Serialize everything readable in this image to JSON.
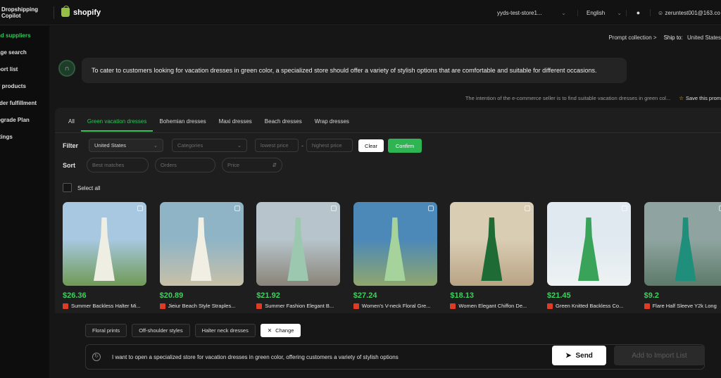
{
  "topbar": {
    "brand_line1": "Dropshipping",
    "brand_line2": "Copilot",
    "platform": "shopify",
    "store": "yyds-test-store1...",
    "language": "English",
    "user": "zeruntest001@163.co"
  },
  "sidebar": {
    "items": [
      {
        "label": "nd suppliers",
        "active": true
      },
      {
        "label": "age search",
        "active": false
      },
      {
        "label": "port list",
        "active": false
      },
      {
        "label": "y products",
        "active": false
      },
      {
        "label": "rder fulfillment",
        "active": false
      },
      {
        "label": "pgrade Plan",
        "active": false
      },
      {
        "label": "ttings",
        "active": false
      }
    ]
  },
  "header": {
    "prompt_collection": "Prompt collection >",
    "ship_to_label": "Ship to:",
    "ship_to_value": "United States"
  },
  "assistant": {
    "message": "To cater to customers looking for vacation dresses in green color, a specialized store should offer a variety of stylish options that are comfortable and suitable for different occasions."
  },
  "intention": {
    "text": "The intention of the e-commerce seller is to find suitable vacation dresses in green col...",
    "save_label": "Save this prom"
  },
  "tabs": [
    "All",
    "Green vacation dresses",
    "Bohemian dresses",
    "Maxi dresses",
    "Beach dresses",
    "Wrap dresses"
  ],
  "filter": {
    "label": "Filter",
    "country": "United States",
    "categories_placeholder": "Categories",
    "lowest_placeholder": "lowest price",
    "dash": "-",
    "highest_placeholder": "highest price",
    "clear": "Clear",
    "confirm": "Confirm"
  },
  "sort": {
    "label": "Sort",
    "best_placeholder": "Best matches",
    "orders_placeholder": "Orders",
    "price_placeholder": "Price"
  },
  "select_all": "Select all",
  "products": [
    {
      "price": "$26.36",
      "title": "Summer Backless Halter Mi...",
      "colors": [
        "#a7c8e0",
        "#6f9a55",
        "#eeeee2"
      ]
    },
    {
      "price": "$20.89",
      "title": "Jieiur Beach Style Straples...",
      "colors": [
        "#8fb4c6",
        "#c8c0a8",
        "#f1efe4"
      ]
    },
    {
      "price": "$21.92",
      "title": "Summer Fashion Elegant B...",
      "colors": [
        "#b7c4cc",
        "#8a8478",
        "#9dc8b0"
      ]
    },
    {
      "price": "$27.24",
      "title": "Women's V-neck Floral Gre...",
      "colors": [
        "#4d89b8",
        "#8fa66c",
        "#a6d39c"
      ]
    },
    {
      "price": "$18.13",
      "title": "Women Elegant Chiffon De...",
      "colors": [
        "#d9cdb4",
        "#b9a384",
        "#1f6b35"
      ]
    },
    {
      "price": "$21.45",
      "title": "Green Knitted Backless Co...",
      "colors": [
        "#dfe9ef",
        "#eef2f3",
        "#3aa35a"
      ]
    },
    {
      "price": "$9.2",
      "title": "Flare Half Sleeve Y2k Long",
      "colors": [
        "#8fa4a0",
        "#5d7a6a",
        "#1f8e7b"
      ]
    }
  ],
  "chips": [
    "Floral prints",
    "Off-shoulder styles",
    "Halter neck dresses"
  ],
  "change_label": "Change",
  "composer": {
    "text": "I want to open a specialized store for vacation dresses in green color, offering customers a variety of stylish options",
    "send": "Send",
    "add_to_import": "Add to Import List"
  },
  "colors": {
    "accent": "#31c55b",
    "price": "#3fd05f",
    "confirm": "#2fb454"
  }
}
